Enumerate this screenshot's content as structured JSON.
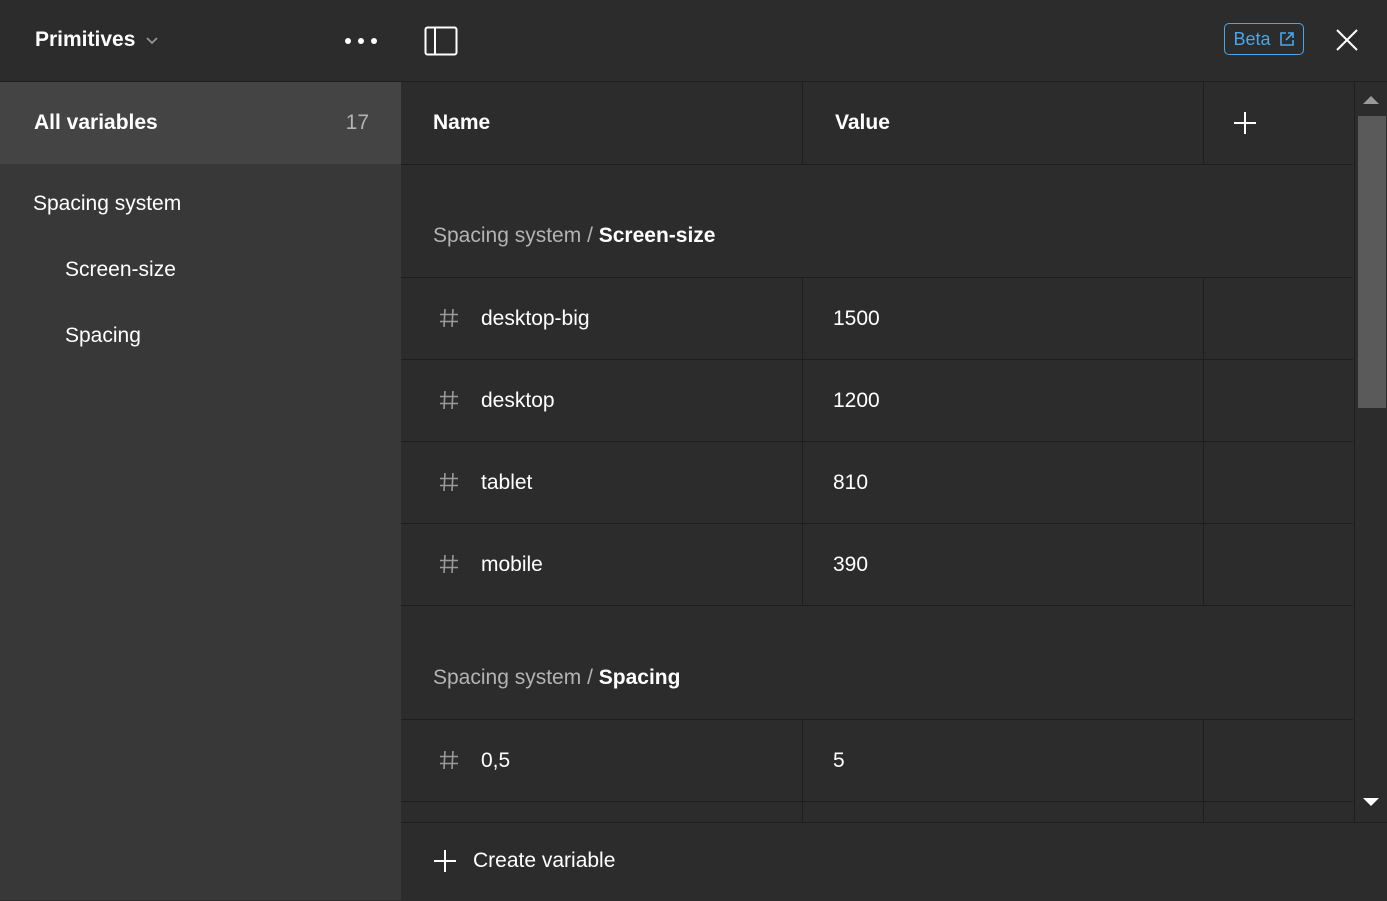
{
  "sidebar": {
    "collection": {
      "title": "Primitives"
    },
    "all_variables": {
      "label": "All variables",
      "count": "17"
    },
    "groups": [
      {
        "label": "Spacing system"
      },
      {
        "label": "Screen-size"
      },
      {
        "label": "Spacing"
      }
    ]
  },
  "topbar": {
    "beta_label": "Beta"
  },
  "table": {
    "columns": [
      "Name",
      "Value"
    ],
    "groups": [
      {
        "parent": "Spacing system",
        "separator": " / ",
        "name": "Screen-size",
        "rows": [
          {
            "name": "desktop-big",
            "value": "1500"
          },
          {
            "name": "desktop",
            "value": "1200"
          },
          {
            "name": "tablet",
            "value": "810"
          },
          {
            "name": "mobile",
            "value": "390"
          }
        ]
      },
      {
        "parent": "Spacing system",
        "separator": " / ",
        "name": "Spacing",
        "rows": [
          {
            "name": "0,5",
            "value": "5"
          }
        ]
      }
    ]
  },
  "footer": {
    "create_label": "Create variable"
  },
  "colors": {
    "accent": "#4aa6e8",
    "background": "#2c2c2c",
    "sidebar": "#383838",
    "selected": "#444444"
  },
  "icons": [
    "chevron-down-icon",
    "more-icon",
    "panel-toggle-icon",
    "external-link-icon",
    "close-icon",
    "plus-icon",
    "number-hash-icon"
  ]
}
